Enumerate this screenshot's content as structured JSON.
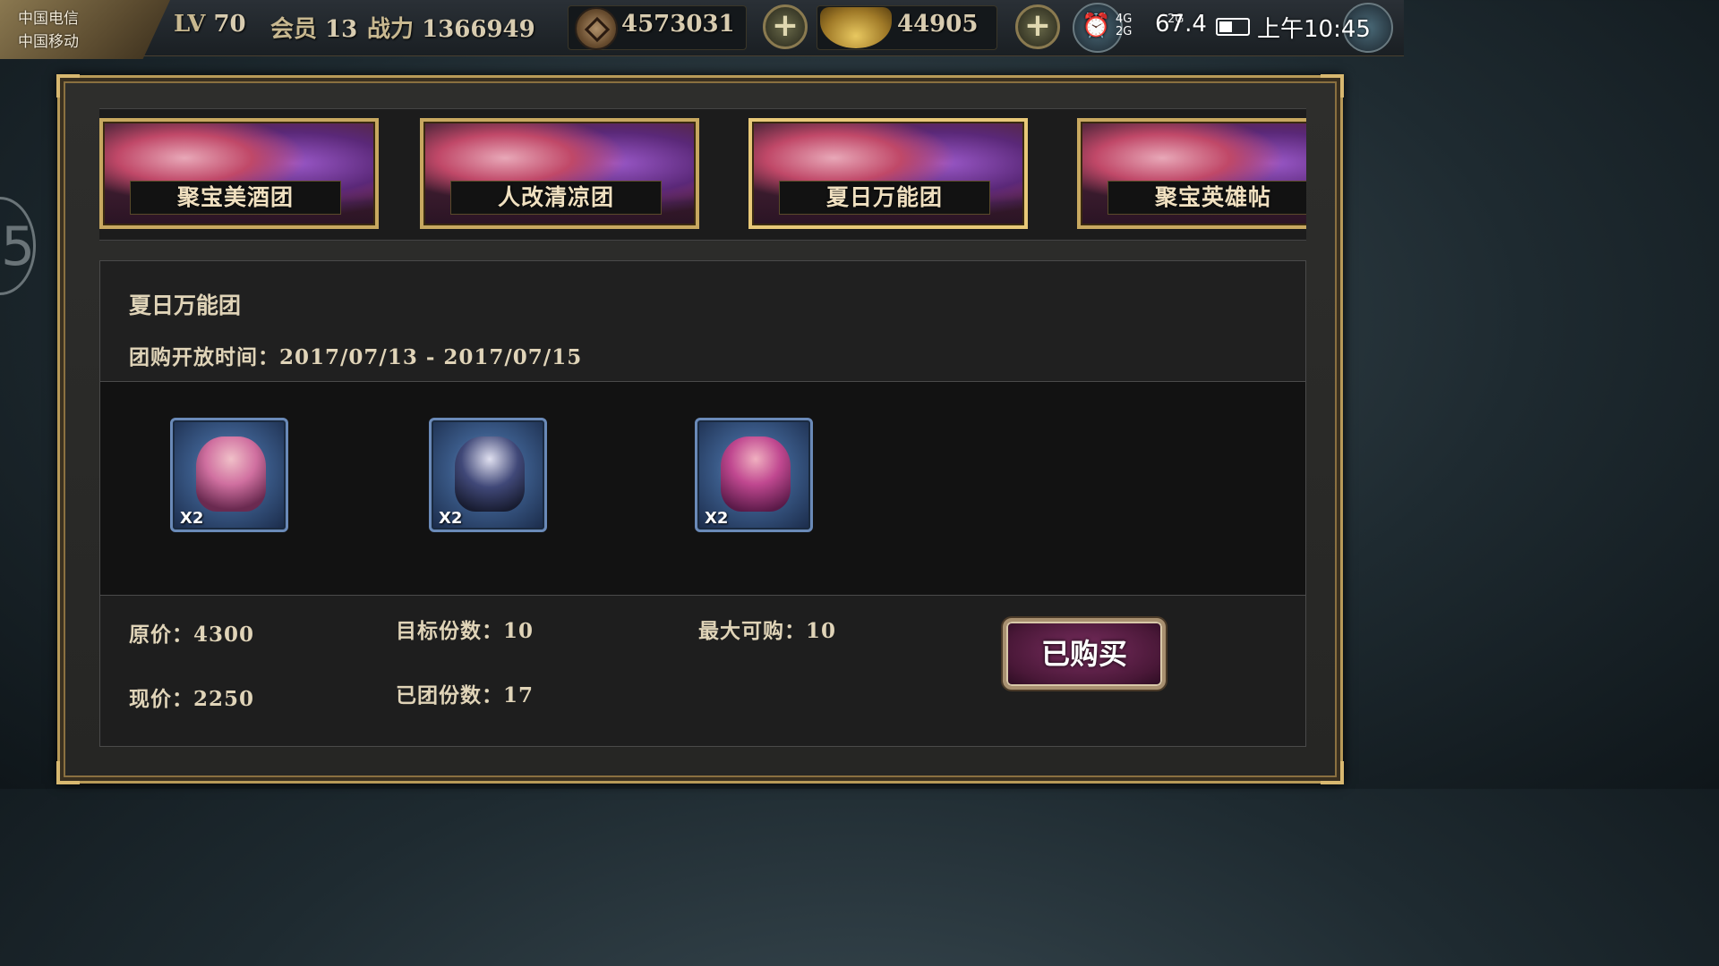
{
  "status_bar": {
    "carrier_1": "中国电信",
    "carrier_2": "中国移动",
    "network_1": "4G",
    "network_2": "2G",
    "network_3": "2G",
    "speed": "67.4",
    "time": "上午10:45"
  },
  "player": {
    "level_label": "LV",
    "level": "70",
    "vip_label": "会员",
    "vip": "13",
    "power_label": "战力",
    "power": "1366949"
  },
  "resources": {
    "coins": "4573031",
    "coin_icon": "coin-icon",
    "ingots": "44905",
    "ingot_icon": "gold-ingot-icon",
    "plus_glyph": "+"
  },
  "tabs": [
    {
      "label": "聚宝美酒团",
      "selected": false
    },
    {
      "label": "人改清凉团",
      "selected": false
    },
    {
      "label": "夏日万能团",
      "selected": true
    },
    {
      "label": "聚宝英雄帖",
      "selected": false
    }
  ],
  "detail": {
    "title": "夏日万能团",
    "open_time_label": "团购开放时间：",
    "open_time_value": "2017/07/13 - 2017/07/15",
    "items": [
      {
        "quantity": "X2",
        "icon": "pink-hair-heroine-portrait"
      },
      {
        "quantity": "X2",
        "icon": "dark-hair-swordsman-portrait"
      },
      {
        "quantity": "X2",
        "icon": "magenta-hair-heroine-portrait"
      }
    ],
    "original_price_label": "原价：",
    "original_price": "4300",
    "current_price_label": "现价：",
    "current_price": "2250",
    "target_label": "目标份数：",
    "target": "10",
    "joined_label": "已团份数：",
    "joined": "17",
    "max_label": "最大可购：",
    "max": "10",
    "button_label": "已购买"
  },
  "side_decoration": "5",
  "colors": {
    "frame_gold": "#c8a860",
    "button_purple": "#7a2e60",
    "item_frame_blue": "#6a8ab8"
  }
}
